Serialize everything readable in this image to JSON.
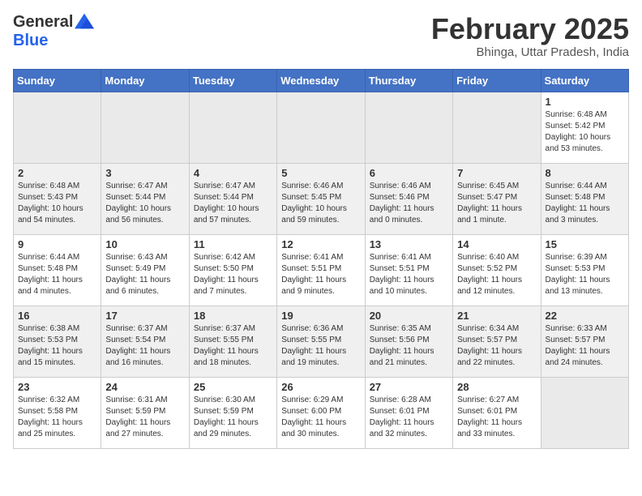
{
  "header": {
    "logo_general": "General",
    "logo_blue": "Blue",
    "month_title": "February 2025",
    "location": "Bhinga, Uttar Pradesh, India"
  },
  "days_of_week": [
    "Sunday",
    "Monday",
    "Tuesday",
    "Wednesday",
    "Thursday",
    "Friday",
    "Saturday"
  ],
  "weeks": [
    [
      {
        "day": "",
        "info": ""
      },
      {
        "day": "",
        "info": ""
      },
      {
        "day": "",
        "info": ""
      },
      {
        "day": "",
        "info": ""
      },
      {
        "day": "",
        "info": ""
      },
      {
        "day": "",
        "info": ""
      },
      {
        "day": "1",
        "info": "Sunrise: 6:48 AM\nSunset: 5:42 PM\nDaylight: 10 hours\nand 53 minutes."
      }
    ],
    [
      {
        "day": "2",
        "info": "Sunrise: 6:48 AM\nSunset: 5:43 PM\nDaylight: 10 hours\nand 54 minutes."
      },
      {
        "day": "3",
        "info": "Sunrise: 6:47 AM\nSunset: 5:44 PM\nDaylight: 10 hours\nand 56 minutes."
      },
      {
        "day": "4",
        "info": "Sunrise: 6:47 AM\nSunset: 5:44 PM\nDaylight: 10 hours\nand 57 minutes."
      },
      {
        "day": "5",
        "info": "Sunrise: 6:46 AM\nSunset: 5:45 PM\nDaylight: 10 hours\nand 59 minutes."
      },
      {
        "day": "6",
        "info": "Sunrise: 6:46 AM\nSunset: 5:46 PM\nDaylight: 11 hours\nand 0 minutes."
      },
      {
        "day": "7",
        "info": "Sunrise: 6:45 AM\nSunset: 5:47 PM\nDaylight: 11 hours\nand 1 minute."
      },
      {
        "day": "8",
        "info": "Sunrise: 6:44 AM\nSunset: 5:48 PM\nDaylight: 11 hours\nand 3 minutes."
      }
    ],
    [
      {
        "day": "9",
        "info": "Sunrise: 6:44 AM\nSunset: 5:48 PM\nDaylight: 11 hours\nand 4 minutes."
      },
      {
        "day": "10",
        "info": "Sunrise: 6:43 AM\nSunset: 5:49 PM\nDaylight: 11 hours\nand 6 minutes."
      },
      {
        "day": "11",
        "info": "Sunrise: 6:42 AM\nSunset: 5:50 PM\nDaylight: 11 hours\nand 7 minutes."
      },
      {
        "day": "12",
        "info": "Sunrise: 6:41 AM\nSunset: 5:51 PM\nDaylight: 11 hours\nand 9 minutes."
      },
      {
        "day": "13",
        "info": "Sunrise: 6:41 AM\nSunset: 5:51 PM\nDaylight: 11 hours\nand 10 minutes."
      },
      {
        "day": "14",
        "info": "Sunrise: 6:40 AM\nSunset: 5:52 PM\nDaylight: 11 hours\nand 12 minutes."
      },
      {
        "day": "15",
        "info": "Sunrise: 6:39 AM\nSunset: 5:53 PM\nDaylight: 11 hours\nand 13 minutes."
      }
    ],
    [
      {
        "day": "16",
        "info": "Sunrise: 6:38 AM\nSunset: 5:53 PM\nDaylight: 11 hours\nand 15 minutes."
      },
      {
        "day": "17",
        "info": "Sunrise: 6:37 AM\nSunset: 5:54 PM\nDaylight: 11 hours\nand 16 minutes."
      },
      {
        "day": "18",
        "info": "Sunrise: 6:37 AM\nSunset: 5:55 PM\nDaylight: 11 hours\nand 18 minutes."
      },
      {
        "day": "19",
        "info": "Sunrise: 6:36 AM\nSunset: 5:55 PM\nDaylight: 11 hours\nand 19 minutes."
      },
      {
        "day": "20",
        "info": "Sunrise: 6:35 AM\nSunset: 5:56 PM\nDaylight: 11 hours\nand 21 minutes."
      },
      {
        "day": "21",
        "info": "Sunrise: 6:34 AM\nSunset: 5:57 PM\nDaylight: 11 hours\nand 22 minutes."
      },
      {
        "day": "22",
        "info": "Sunrise: 6:33 AM\nSunset: 5:57 PM\nDaylight: 11 hours\nand 24 minutes."
      }
    ],
    [
      {
        "day": "23",
        "info": "Sunrise: 6:32 AM\nSunset: 5:58 PM\nDaylight: 11 hours\nand 25 minutes."
      },
      {
        "day": "24",
        "info": "Sunrise: 6:31 AM\nSunset: 5:59 PM\nDaylight: 11 hours\nand 27 minutes."
      },
      {
        "day": "25",
        "info": "Sunrise: 6:30 AM\nSunset: 5:59 PM\nDaylight: 11 hours\nand 29 minutes."
      },
      {
        "day": "26",
        "info": "Sunrise: 6:29 AM\nSunset: 6:00 PM\nDaylight: 11 hours\nand 30 minutes."
      },
      {
        "day": "27",
        "info": "Sunrise: 6:28 AM\nSunset: 6:01 PM\nDaylight: 11 hours\nand 32 minutes."
      },
      {
        "day": "28",
        "info": "Sunrise: 6:27 AM\nSunset: 6:01 PM\nDaylight: 11 hours\nand 33 minutes."
      },
      {
        "day": "",
        "info": ""
      }
    ]
  ]
}
